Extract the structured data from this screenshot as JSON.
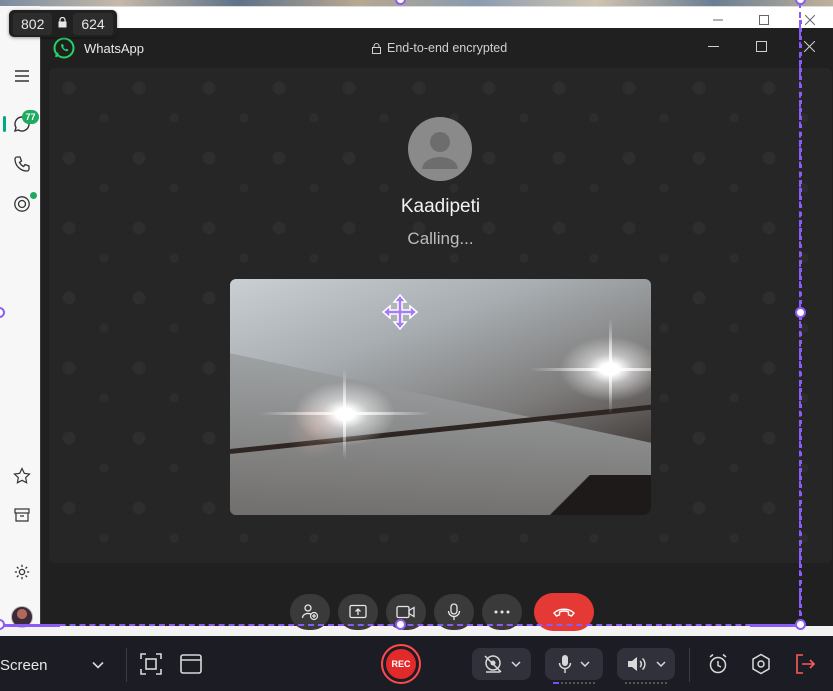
{
  "overlay": {
    "width_value": "802",
    "height_value": "624"
  },
  "back_window": {
    "badge_count": "77"
  },
  "call_window": {
    "app_name": "WhatsApp",
    "encryption_text": "End-to-end encrypted",
    "callee_name": "Kaadipeti",
    "call_status": "Calling..."
  },
  "recorder_toolbar": {
    "source_label": "Screen",
    "rec_label": "REC"
  },
  "colors": {
    "selection_accent": "#8a5cf5",
    "end_call_red": "#e53935",
    "whatsapp_green": "#1daa61",
    "rec_red": "#e22a2a"
  },
  "icons": {
    "rail": [
      "menu-icon",
      "chats-icon",
      "calls-icon",
      "status-icon",
      "starred-icon",
      "archive-icon",
      "settings-icon"
    ],
    "call_controls": [
      "add-participant-icon",
      "share-screen-icon",
      "video-camera-icon",
      "microphone-icon",
      "more-icon",
      "end-call-icon"
    ],
    "toolbar": [
      "chevron-down-icon",
      "region-select-icon",
      "window-select-icon",
      "webcam-off-icon",
      "microphone-icon",
      "speaker-icon",
      "alarm-clock-icon",
      "settings-icon",
      "exit-icon"
    ]
  }
}
